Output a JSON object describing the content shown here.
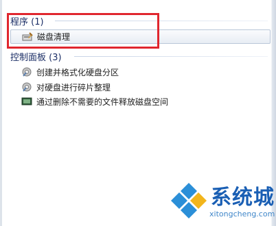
{
  "sections": {
    "programs": {
      "header": "程序 (1)"
    },
    "control_panel": {
      "header": "控制面板 (3)"
    }
  },
  "program_items": [
    {
      "label": "磁盘清理",
      "icon": "disk-cleanup-icon"
    }
  ],
  "control_panel_items": [
    {
      "label": "创建并格式化硬盘分区",
      "icon": "admin-tools-icon"
    },
    {
      "label": "对硬盘进行碎片整理",
      "icon": "admin-tools-icon"
    },
    {
      "label": "通过删除不需要的文件释放磁盘空间",
      "icon": "control-panel-icon"
    }
  ],
  "watermark": {
    "name": "系统城",
    "url": "xitongcheng.com"
  },
  "colors": {
    "highlight_border": "#e0262e",
    "header_text": "#1b2e66",
    "brand": "#1a5fb4"
  }
}
